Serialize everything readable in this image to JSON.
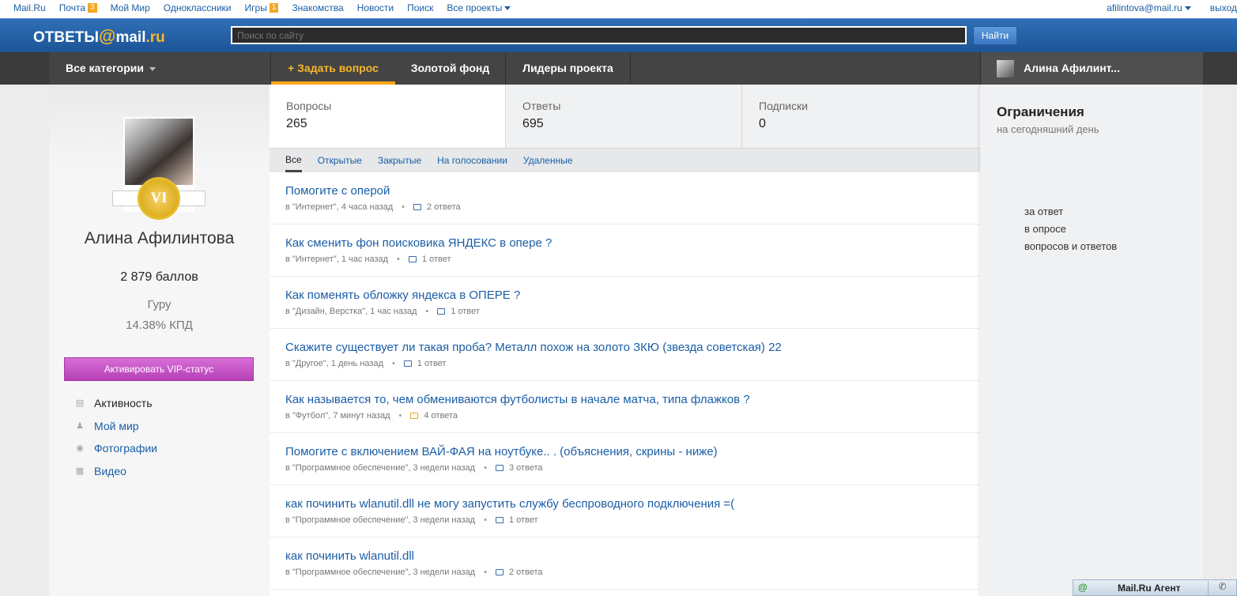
{
  "portal": {
    "links": [
      {
        "label": "Mail.Ru",
        "badge": ""
      },
      {
        "label": "Почта",
        "badge": "3"
      },
      {
        "label": "Мой Мир",
        "badge": ""
      },
      {
        "label": "Одноклассники",
        "badge": ""
      },
      {
        "label": "Игры",
        "badge": "1"
      },
      {
        "label": "Знакомства",
        "badge": ""
      },
      {
        "label": "Новости",
        "badge": ""
      },
      {
        "label": "Поиск",
        "badge": ""
      },
      {
        "label": "Все проекты",
        "badge": ""
      }
    ],
    "user_email": "afilintova@mail.ru",
    "logout": "выход"
  },
  "header": {
    "logo_left": "ОТВЕТЫ",
    "logo_at": "@",
    "logo_right": "mail",
    "logo_ru": ".ru",
    "search_placeholder": "Поиск по сайту",
    "search_button": "Найти"
  },
  "nav": {
    "categories": "Все категории",
    "ask": "+ Задать вопрос",
    "gold": "Золотой фонд",
    "leaders": "Лидеры проекта",
    "user_name": "Алина Афилинт..."
  },
  "profile": {
    "medal": "VI",
    "name": "Алина Афилинтова",
    "points": "2 879 баллов",
    "rank": "Гуру",
    "kpd": "14.38% КПД",
    "vip_button": "Активировать VIP-статус",
    "menu": [
      {
        "label": "Активность",
        "icon": "list-icon"
      },
      {
        "label": "Мой мир",
        "icon": "person-icon"
      },
      {
        "label": "Фотографии",
        "icon": "camera-icon"
      },
      {
        "label": "Видео",
        "icon": "film-icon"
      }
    ]
  },
  "stats": [
    {
      "label": "Вопросы",
      "value": "265"
    },
    {
      "label": "Ответы",
      "value": "695"
    },
    {
      "label": "Подписки",
      "value": "0"
    }
  ],
  "filters": [
    "Все",
    "Открытые",
    "Закрытые",
    "На голосовании",
    "Удаленные"
  ],
  "questions": [
    {
      "title": "Помогите с оперой",
      "meta": "в \"Интернет\", 4 часа назад",
      "answers": "2 ответа",
      "hot": false
    },
    {
      "title": "Как сменить фон поисковика ЯНДЕКС в опере ?",
      "meta": "в \"Интернет\", 1 час назад",
      "answers": "1 ответ",
      "hot": false
    },
    {
      "title": "Как поменять обложку яндекса в ОПЕРЕ ?",
      "meta": "в \"Дизайн, Верстка\", 1 час назад",
      "answers": "1 ответ",
      "hot": false
    },
    {
      "title": "Скажите существует ли такая проба? Металл похож на золото ЗКЮ (звезда советская) 22",
      "meta": "в \"Другое\", 1 день назад",
      "answers": "1 ответ",
      "hot": false
    },
    {
      "title": "Как называется то, чем обмениваются футболисты в начале матча, типа флажков ?",
      "meta": "в \"Футбол\", 7 минут назад",
      "answers": "4 ответа",
      "hot": true
    },
    {
      "title": "Помогите с включением ВАЙ-ФАЯ на ноутбуке.. . (объяснения, скрины - ниже)",
      "meta": "в \"Программное обеспечение\", 3 недели назад",
      "answers": "3 ответа",
      "hot": false
    },
    {
      "title": "как починить wlanutil.dll не могу запустить службу беспроводного подключения =(",
      "meta": "в \"Программное обеспечение\", 3 недели назад",
      "answers": "1 ответ",
      "hot": false
    },
    {
      "title": "как починить wlanutil.dll",
      "meta": "в \"Программное обеспечение\", 3 недели назад",
      "answers": "2 ответа",
      "hot": false
    }
  ],
  "limits": {
    "title": "Ограничения",
    "subtitle": "на сегодняшний день",
    "items": [
      "за ответ",
      "в опросе",
      "вопросов и ответов"
    ]
  },
  "agent": {
    "icon": "@",
    "label": "Mail.Ru Агент"
  }
}
